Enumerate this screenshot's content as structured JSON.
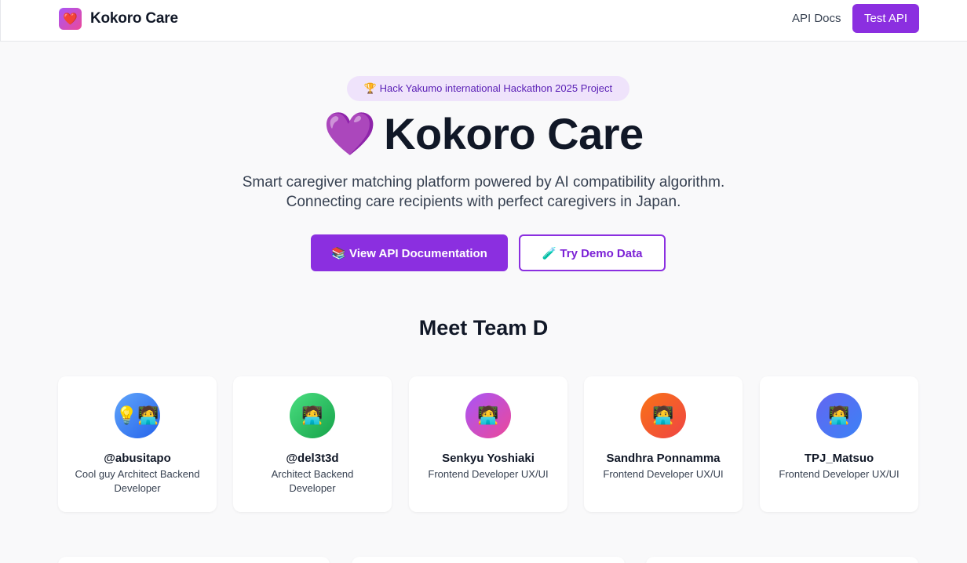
{
  "header": {
    "logo_icon": "❤️",
    "brand": "Kokoro Care",
    "nav_docs": "API Docs",
    "nav_test": "Test API"
  },
  "hero": {
    "badge": "🏆 Hack Yakumo international Hackathon 2025 Project",
    "title_icon": "💜",
    "title": "Kokoro Care",
    "subtitle_line1": "Smart caregiver matching platform powered by AI compatibility algorithm.",
    "subtitle_line2": "Connecting care recipients with perfect caregivers in Japan.",
    "primary_button": "📚 View API Documentation",
    "secondary_button": "🧪 Try Demo Data"
  },
  "team": {
    "title": "Meet Team D",
    "members": [
      {
        "avatar": "💡🧑‍💻",
        "name": "@abusitapo",
        "role": "Cool guy Architect Backend Developer"
      },
      {
        "avatar": "🧑‍💻",
        "name": "@del3t3d",
        "role": "Architect Backend Developer"
      },
      {
        "avatar": "🧑‍💻",
        "name": "Senkyu Yoshiaki",
        "role": "Frontend Developer UX/UI"
      },
      {
        "avatar": "🧑‍💻",
        "name": "Sandhra Ponnamma",
        "role": "Frontend Developer UX/UI"
      },
      {
        "avatar": "🧑‍💻",
        "name": "TPJ_Matsuo",
        "role": "Frontend Developer UX/UI"
      }
    ]
  },
  "colors": {
    "accent": "#8b2fe0",
    "badge_bg": "#efe3fb",
    "avatar_gradients": [
      [
        "#60a5fa",
        "#2563eb"
      ],
      [
        "#4ade80",
        "#16a34a"
      ],
      [
        "#a855f7",
        "#ec4899"
      ],
      [
        "#f97316",
        "#ef4444"
      ],
      [
        "#6366f1",
        "#3b82f6"
      ]
    ]
  }
}
